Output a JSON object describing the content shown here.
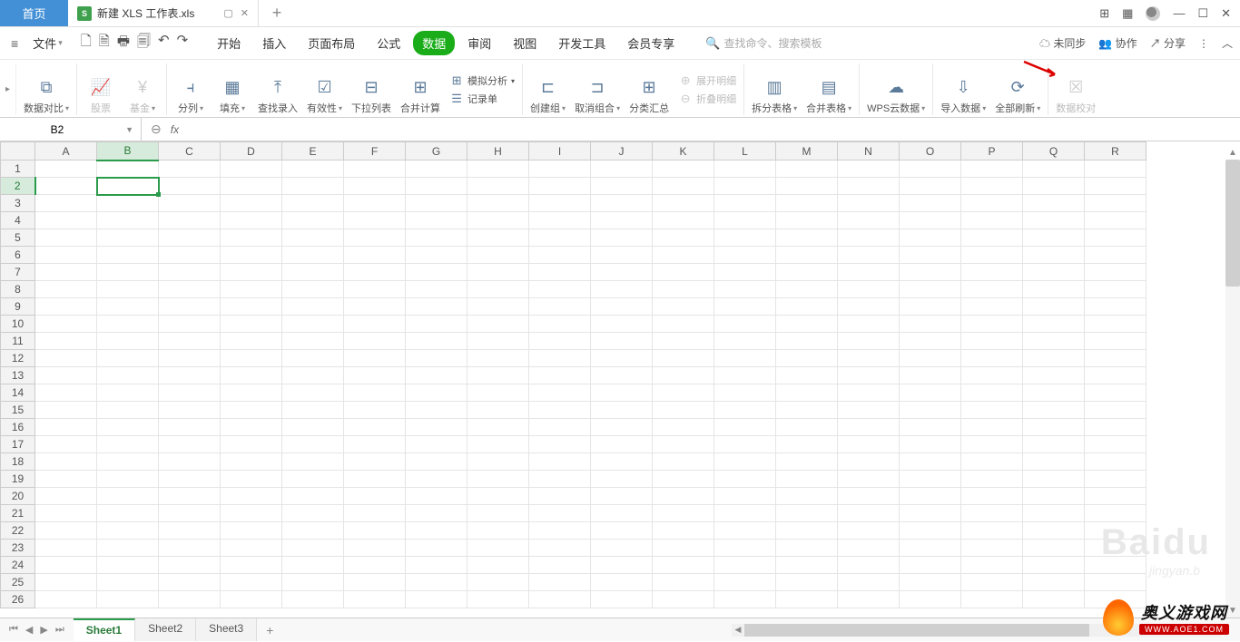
{
  "title_bar": {
    "home_tab": "首页",
    "file_icon_letter": "S",
    "file_name": "新建 XLS 工作表.xls",
    "add_label": "+"
  },
  "menu": {
    "file_label": "文件",
    "tabs": [
      "开始",
      "插入",
      "页面布局",
      "公式",
      "数据",
      "审阅",
      "视图",
      "开发工具",
      "会员专享"
    ],
    "active_tab_index": 4,
    "search_placeholder": "查找命令、搜索模板",
    "unsync": "未同步",
    "collab": "协作",
    "share": "分享"
  },
  "ribbon": {
    "data_compare": "数据对比",
    "stock": "股票",
    "fund": "基金",
    "split_col": "分列",
    "fill": "填充",
    "find_entry": "查找录入",
    "validity": "有效性",
    "dropdown_list": "下拉列表",
    "consolidate": "合并计算",
    "simulate": "模拟分析",
    "record_form": "记录单",
    "create_group": "创建组",
    "ungroup": "取消组合",
    "subtotal": "分类汇总",
    "expand_detail": "展开明细",
    "collapse_detail": "折叠明细",
    "split_table": "拆分表格",
    "merge_table": "合并表格",
    "wps_cloud": "WPS云数据",
    "import_data": "导入数据",
    "refresh_all": "全部刷新",
    "data_check": "数据校对"
  },
  "formula_bar": {
    "cell_ref": "B2",
    "fx_label": "fx"
  },
  "columns": [
    "A",
    "B",
    "C",
    "D",
    "E",
    "F",
    "G",
    "H",
    "I",
    "J",
    "K",
    "L",
    "M",
    "N",
    "O",
    "P",
    "Q",
    "R"
  ],
  "rows": [
    1,
    2,
    3,
    4,
    5,
    6,
    7,
    8,
    9,
    10,
    11,
    12,
    13,
    14,
    15,
    16,
    17,
    18,
    19,
    20,
    21,
    22,
    23,
    24,
    25,
    26
  ],
  "active_cell": {
    "col": "B",
    "row": 2,
    "col_index": 1,
    "row_index": 1
  },
  "sheet_tabs": [
    "Sheet1",
    "Sheet2",
    "Sheet3"
  ],
  "active_sheet_index": 0,
  "watermark": {
    "main": "Baidu",
    "sub": "jingyan.b",
    "logo_cn": "奥义游戏网",
    "logo_url": "WWW.AOE1.COM"
  }
}
